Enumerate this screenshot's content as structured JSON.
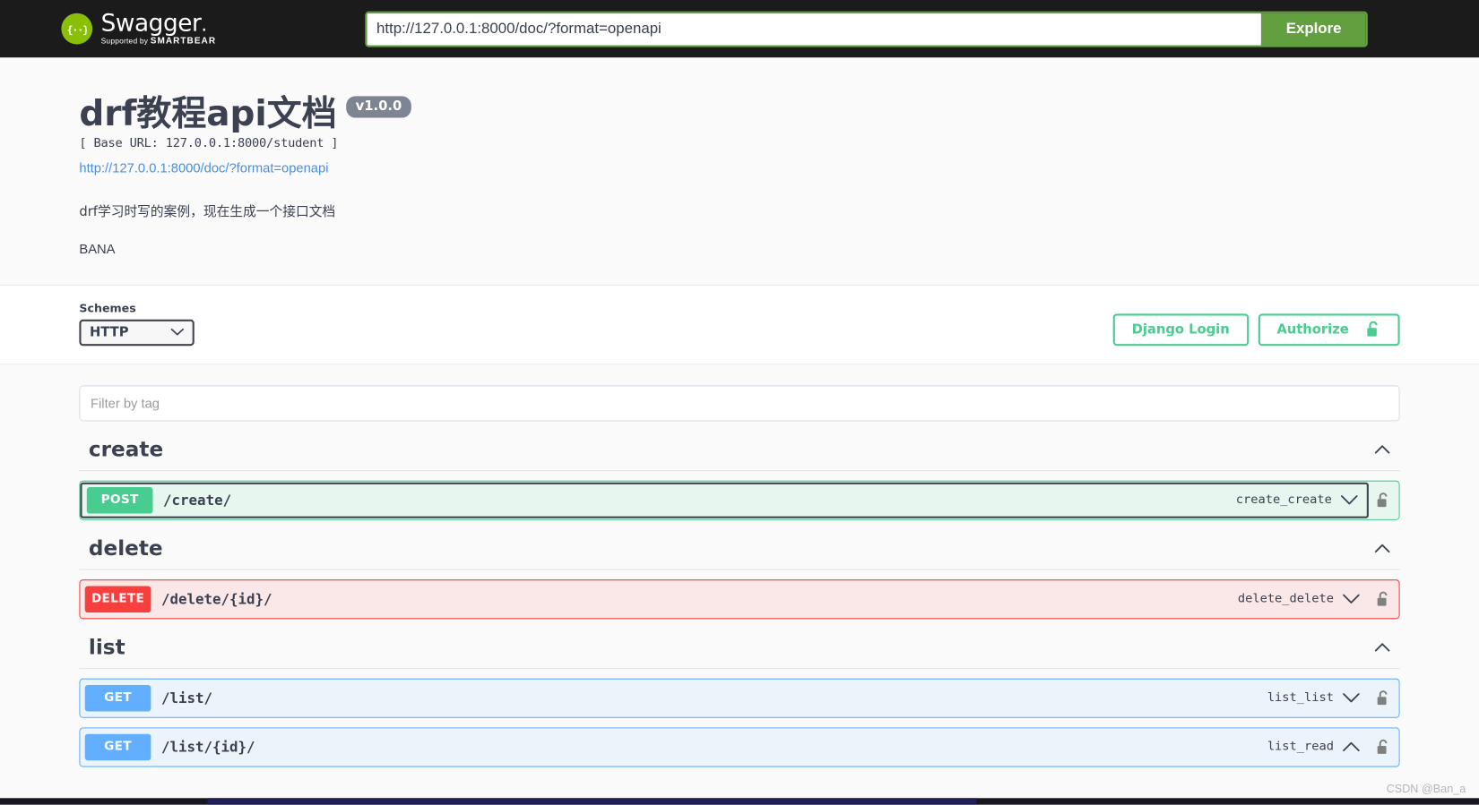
{
  "topbar": {
    "logo_text": "Swagger",
    "logo_mark": "{...}",
    "logo_supported_pre": "Supported by ",
    "logo_supported_brand": "SMARTBEAR",
    "url_value": "http://127.0.0.1:8000/doc/?format=openapi",
    "url_placeholder": "http://127.0.0.1:8000/doc/?format=openapi",
    "explore_label": "Explore"
  },
  "info": {
    "title": "drf教程api文档",
    "version": "v1.0.0",
    "base_url": "[ Base URL: 127.0.0.1:8000/student ]",
    "spec_link": "http://127.0.0.1:8000/doc/?format=openapi",
    "description": "drf学习时写的案例，现在生成一个接口文档",
    "contact": "BANA"
  },
  "scheme_bar": {
    "schemes_label": "Schemes",
    "scheme_selected": "HTTP",
    "scheme_options": [
      "HTTP"
    ],
    "django_login_label": "Django Login",
    "authorize_label": "Authorize",
    "authorize_icon": "unlock-icon"
  },
  "filter": {
    "placeholder": "Filter by tag",
    "value": ""
  },
  "sections": [
    {
      "tag": "create",
      "collapse_icon": "chevron-up-icon",
      "operations": [
        {
          "method": "POST",
          "method_class": "post",
          "path": "/create/",
          "operation_id": "create_create",
          "toggle_icon": "chevron-down-icon",
          "lock_icon": "unlock-icon",
          "focused": true
        }
      ]
    },
    {
      "tag": "delete",
      "collapse_icon": "chevron-up-icon",
      "operations": [
        {
          "method": "DELETE",
          "method_class": "delete",
          "path": "/delete/{id}/",
          "operation_id": "delete_delete",
          "toggle_icon": "chevron-down-icon",
          "lock_icon": "unlock-icon",
          "focused": false
        }
      ]
    },
    {
      "tag": "list",
      "collapse_icon": "chevron-up-icon",
      "operations": [
        {
          "method": "GET",
          "method_class": "get",
          "path": "/list/",
          "operation_id": "list_list",
          "toggle_icon": "chevron-down-icon",
          "lock_icon": "unlock-icon",
          "focused": false
        },
        {
          "method": "GET",
          "method_class": "get",
          "path": "/list/{id}/",
          "operation_id": "list_read",
          "toggle_icon": "chevron-up-icon",
          "lock_icon": "unlock-icon",
          "focused": false
        }
      ]
    }
  ],
  "watermark": "CSDN @Ban_a",
  "colors": {
    "swagger_green": "#89bf04",
    "explore_green": "#62a03f",
    "post": "#49cc90",
    "delete": "#f93e3e",
    "get": "#61affe",
    "topbar_bg": "#1b1b1b",
    "text": "#3b4151",
    "link": "#4990e2",
    "version_badge": "#7d8492"
  }
}
